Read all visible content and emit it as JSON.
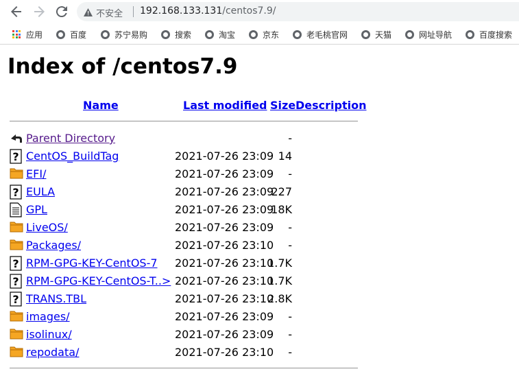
{
  "browser": {
    "security_label": "不安全",
    "url_host": "192.168.133.131",
    "url_path": "/centos7.9/"
  },
  "bookmarks": {
    "apps_label": "应用",
    "items": [
      {
        "label": "百度"
      },
      {
        "label": "苏宁易购"
      },
      {
        "label": "搜索"
      },
      {
        "label": "淘宝"
      },
      {
        "label": "京东"
      },
      {
        "label": "老毛桃官网"
      },
      {
        "label": "天猫"
      },
      {
        "label": "网址导航"
      },
      {
        "label": "百度搜索"
      }
    ]
  },
  "page": {
    "title": "Index of /centos7.9",
    "columns": {
      "name": "Name",
      "modified": "Last modified",
      "size": "Size",
      "description": "Description"
    },
    "parent": {
      "name": "Parent Directory",
      "modified": "",
      "size": "-",
      "icon": "back-arrow-icon"
    },
    "entries": [
      {
        "name": "CentOS_BuildTag",
        "modified": "2021-07-26 23:09",
        "size": "14",
        "icon": "unknown-file-icon"
      },
      {
        "name": "EFI/",
        "modified": "2021-07-26 23:09",
        "size": "-",
        "icon": "folder-icon"
      },
      {
        "name": "EULA",
        "modified": "2021-07-26 23:09",
        "size": "227",
        "icon": "unknown-file-icon"
      },
      {
        "name": "GPL",
        "modified": "2021-07-26 23:09",
        "size": "18K",
        "icon": "text-file-icon"
      },
      {
        "name": "LiveOS/",
        "modified": "2021-07-26 23:09",
        "size": "-",
        "icon": "folder-icon"
      },
      {
        "name": "Packages/",
        "modified": "2021-07-26 23:10",
        "size": "-",
        "icon": "folder-icon"
      },
      {
        "name": "RPM-GPG-KEY-CentOS-7",
        "modified": "2021-07-26 23:10",
        "size": "1.7K",
        "icon": "unknown-file-icon"
      },
      {
        "name": "RPM-GPG-KEY-CentOS-T..>",
        "modified": "2021-07-26 23:10",
        "size": "1.7K",
        "icon": "unknown-file-icon"
      },
      {
        "name": "TRANS.TBL",
        "modified": "2021-07-26 23:10",
        "size": "2.8K",
        "icon": "unknown-file-icon"
      },
      {
        "name": "images/",
        "modified": "2021-07-26 23:09",
        "size": "-",
        "icon": "folder-icon"
      },
      {
        "name": "isolinux/",
        "modified": "2021-07-26 23:09",
        "size": "-",
        "icon": "folder-icon"
      },
      {
        "name": "repodata/",
        "modified": "2021-07-26 23:10",
        "size": "-",
        "icon": "folder-icon"
      }
    ]
  }
}
